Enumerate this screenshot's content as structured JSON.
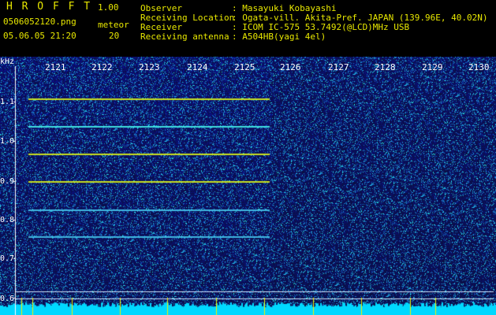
{
  "header": {
    "app_title": "H R O F F T",
    "version": "1.00",
    "filename": "0506052120.png",
    "datetime": "05.06.05 21:20",
    "meteor_label": "meteor",
    "meteor_count": "20",
    "info_labels": [
      "Observer",
      "Receiving Location",
      "Receiver",
      "Receiving antenna"
    ],
    "info_values": [
      ": Masayuki Kobayashi",
      ": Ogata-vill. Akita-Pref. JAPAN (139.96E, 40.02N)",
      ": ICOM IC-575 53.7492(@LCD)MHz USB",
      ": A504HB(yagi 4el)"
    ]
  },
  "plot": {
    "y_unit": "kHz",
    "y_ticks": [
      "1.1",
      "1.0",
      "0.9",
      "0.8",
      "0.7",
      "0.6"
    ],
    "x_ticks": [
      "2121",
      "2122",
      "2123",
      "2124",
      "2125",
      "2126",
      "2127",
      "2128",
      "2129",
      "2130"
    ],
    "colors": {
      "background": "#101060",
      "signal": "#00e0ff",
      "text": "#ffffff",
      "accent": "#e8e800"
    }
  }
}
